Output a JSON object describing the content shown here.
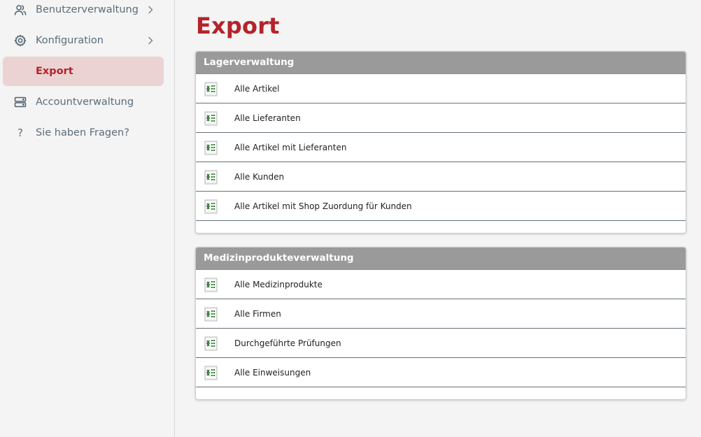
{
  "sidebar": {
    "items": [
      {
        "label": "Benutzerverwaltung",
        "icon": "users-icon",
        "has_chevron": true,
        "active": false
      },
      {
        "label": "Konfiguration",
        "icon": "gear-icon",
        "has_chevron": true,
        "active": false
      },
      {
        "label": "Export",
        "icon": "",
        "has_chevron": false,
        "active": true
      },
      {
        "label": "Accountverwaltung",
        "icon": "server-icon",
        "has_chevron": false,
        "active": false
      },
      {
        "label": "Sie haben Fragen?",
        "icon": "question-icon",
        "has_chevron": false,
        "active": false
      }
    ]
  },
  "main": {
    "title": "Export",
    "sections": [
      {
        "title": "Lagerverwaltung",
        "items": [
          {
            "label": "Alle Artikel",
            "icon": "excel-icon"
          },
          {
            "label": "Alle Lieferanten",
            "icon": "excel-icon"
          },
          {
            "label": "Alle Artikel mit Lieferanten",
            "icon": "excel-icon"
          },
          {
            "label": "Alle Kunden",
            "icon": "excel-icon"
          },
          {
            "label": "Alle Artikel mit Shop Zuordung für Kunden",
            "icon": "excel-icon"
          }
        ]
      },
      {
        "title": "Medizinprodukteverwaltung",
        "items": [
          {
            "label": "Alle Medizinprodukte",
            "icon": "excel-icon"
          },
          {
            "label": "Alle Firmen",
            "icon": "excel-icon"
          },
          {
            "label": "Durchgeführte Prüfungen",
            "icon": "excel-icon"
          },
          {
            "label": "Alle Einweisungen",
            "icon": "excel-icon"
          }
        ]
      }
    ]
  },
  "colors": {
    "accent": "#b5232b",
    "active_bg": "#ecd3d3",
    "panel_header": "#9a9a9a",
    "background": "#f3f4f3"
  }
}
